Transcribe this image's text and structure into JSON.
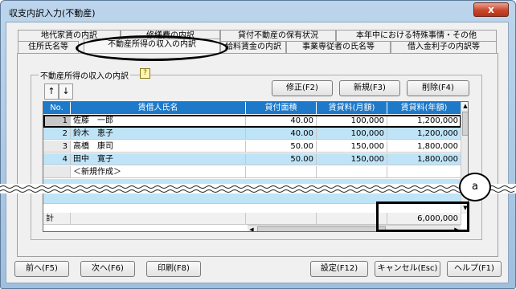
{
  "window": {
    "title": "収支内訳入力(不動産)",
    "close_label": "x"
  },
  "tabs_row1": [
    {
      "label": "地代家賃の内訳"
    },
    {
      "label": "修繕費の内訳"
    },
    {
      "label": "貸付不動産の保有状況"
    },
    {
      "label": "本年中における特殊事情・その他"
    }
  ],
  "tabs_row2": [
    {
      "label": "住所氏名等"
    },
    {
      "label": "不動産所得の収入の内訳"
    },
    {
      "label": "給料賃金の内訳"
    },
    {
      "label": "事業専従者の氏名等"
    },
    {
      "label": "借入金利子の内訳等"
    }
  ],
  "group": {
    "label": "不動産所得の収入の内訳",
    "hint_icon": "?"
  },
  "arrows": {
    "up": "↑",
    "down": "↓"
  },
  "grid_buttons": {
    "edit": "修正(F2)",
    "new": "新規(F3)",
    "delete": "削除(F4)"
  },
  "grid": {
    "headers": [
      "No.",
      "賃借人氏名",
      "貸付面積",
      "賃貸料(月額)",
      "賃貸料(年額)"
    ],
    "rows": [
      {
        "no": "1",
        "name": "佐藤　一郎",
        "area": "40.00",
        "monthly": "100,000",
        "yearly": "1,200,000"
      },
      {
        "no": "2",
        "name": "鈴木　恵子",
        "area": "40.00",
        "monthly": "100,000",
        "yearly": "1,200,000"
      },
      {
        "no": "3",
        "name": "高橋　康司",
        "area": "50.00",
        "monthly": "150,000",
        "yearly": "1,800,000"
      },
      {
        "no": "4",
        "name": "田中　寛子",
        "area": "50.00",
        "monthly": "150,000",
        "yearly": "1,800,000"
      }
    ],
    "new_row_label": "＜新規作成＞",
    "total_label": "計",
    "total_yearly": "6,000,000"
  },
  "callout_label": "a",
  "footer_buttons": {
    "prev": "前へ(F5)",
    "next": "次へ(F6)",
    "print": "印刷(F8)",
    "settings": "設定(F12)",
    "cancel": "キャンセル(Esc)",
    "help": "ヘルプ(F1)"
  }
}
